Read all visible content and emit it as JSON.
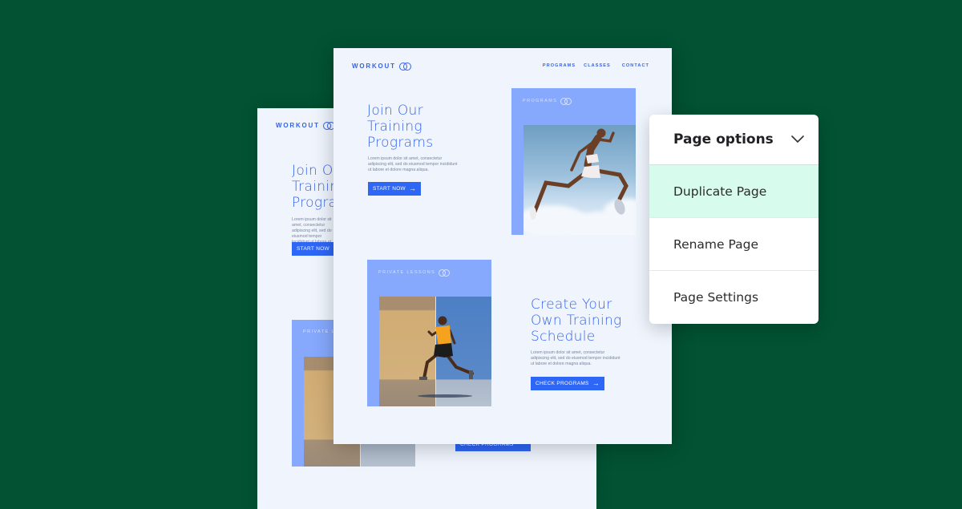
{
  "background_color": "#025233",
  "back_page": {
    "logo": "WORKOUT",
    "headline_lines": [
      "Join Our",
      "Training",
      "Programs"
    ],
    "lorem": "Lorem ipsum dolor sit amet, consectetur adipiscing elit, sed do eiusmod tempor incididunt ut labore et dolore magna aliqua.",
    "cta_label": "START NOW",
    "card_label": "PRIVATE LESSONS",
    "cta2_label": "CHECK PROGRAMS"
  },
  "front_page": {
    "logo": "WORKOUT",
    "nav": [
      "PROGRAMS",
      "CLASSES",
      "CONTACT"
    ],
    "hero": {
      "headline_lines": [
        "Join Our",
        "Training",
        "Programs"
      ],
      "lorem_lines": [
        "Lorem ipsum dolor sit amet, consectetur",
        "adipiscing elit, sed do eiusmod tempor incididunt",
        "ut labore et dolore magna aliqua."
      ],
      "cta_label": "START NOW",
      "card_label": "PROGRAMS"
    },
    "section2": {
      "card_label": "PRIVATE LESSONS",
      "headline_lines": [
        "Create Your",
        "Own Training",
        "Schedule"
      ],
      "lorem_lines": [
        "Lorem ipsum dolor sit amet, consectetur",
        "adipiscing elit, sed do eiusmod tempor incididunt",
        "ut labore et dolore magna aliqua."
      ],
      "cta_label": "CHECK PROGRAMS"
    },
    "arrow_icon": "→"
  },
  "menu": {
    "title": "Page options",
    "items": [
      {
        "label": "Duplicate Page",
        "active": true
      },
      {
        "label": "Rename Page",
        "active": false
      },
      {
        "label": "Page Settings",
        "active": false
      }
    ],
    "highlight_color": "#d7fbec"
  }
}
